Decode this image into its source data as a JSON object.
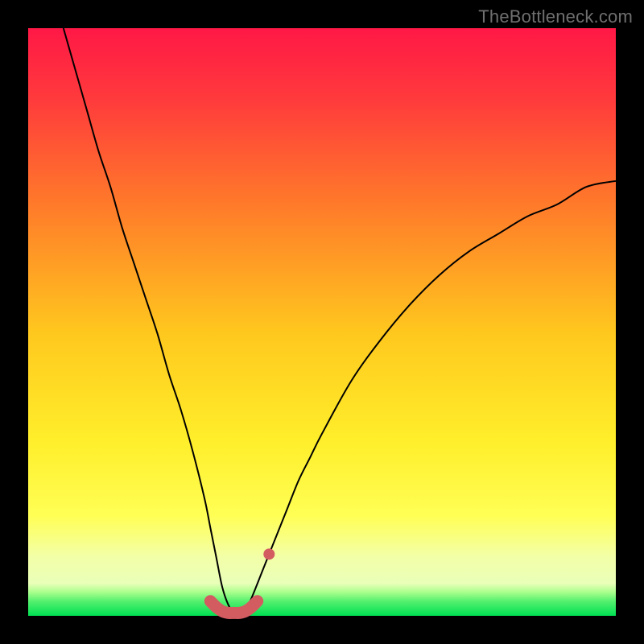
{
  "watermark": "TheBottleneck.com",
  "chart_data": {
    "type": "line",
    "title": "",
    "xlabel": "",
    "ylabel": "",
    "xlim": [
      0,
      100
    ],
    "ylim": [
      0,
      100
    ],
    "grid": false,
    "legend": null,
    "series": [
      {
        "name": "bottleneck-curve",
        "x": [
          6,
          8,
          10,
          12,
          14,
          16,
          18,
          20,
          22,
          24,
          26,
          28,
          30,
          31,
          32,
          33,
          34,
          35,
          36,
          37,
          38,
          40,
          42,
          44,
          46,
          48,
          50,
          55,
          60,
          65,
          70,
          75,
          80,
          85,
          90,
          95,
          100
        ],
        "y": [
          100,
          93,
          86,
          79,
          73,
          66,
          60,
          54,
          48,
          41,
          35,
          28,
          20,
          15,
          10,
          5,
          2,
          0.5,
          0.5,
          1,
          3,
          8,
          13,
          18,
          23,
          27,
          31,
          40,
          47,
          53,
          58,
          62,
          65,
          68,
          70,
          73,
          74
        ]
      },
      {
        "name": "optimal-range-overlay",
        "x": [
          31,
          32,
          33,
          34,
          35,
          36,
          37,
          38,
          39
        ],
        "y": [
          2.5,
          1.5,
          0.8,
          0.5,
          0.5,
          0.5,
          0.8,
          1.5,
          2.5
        ]
      }
    ],
    "colors": {
      "background_gradient": [
        "#ff1846",
        "#ff6a2a",
        "#ffd400",
        "#ffff4a",
        "#f5ffb0",
        "#00e052"
      ],
      "curve": "#000000",
      "overlay": "#d35c61"
    }
  }
}
